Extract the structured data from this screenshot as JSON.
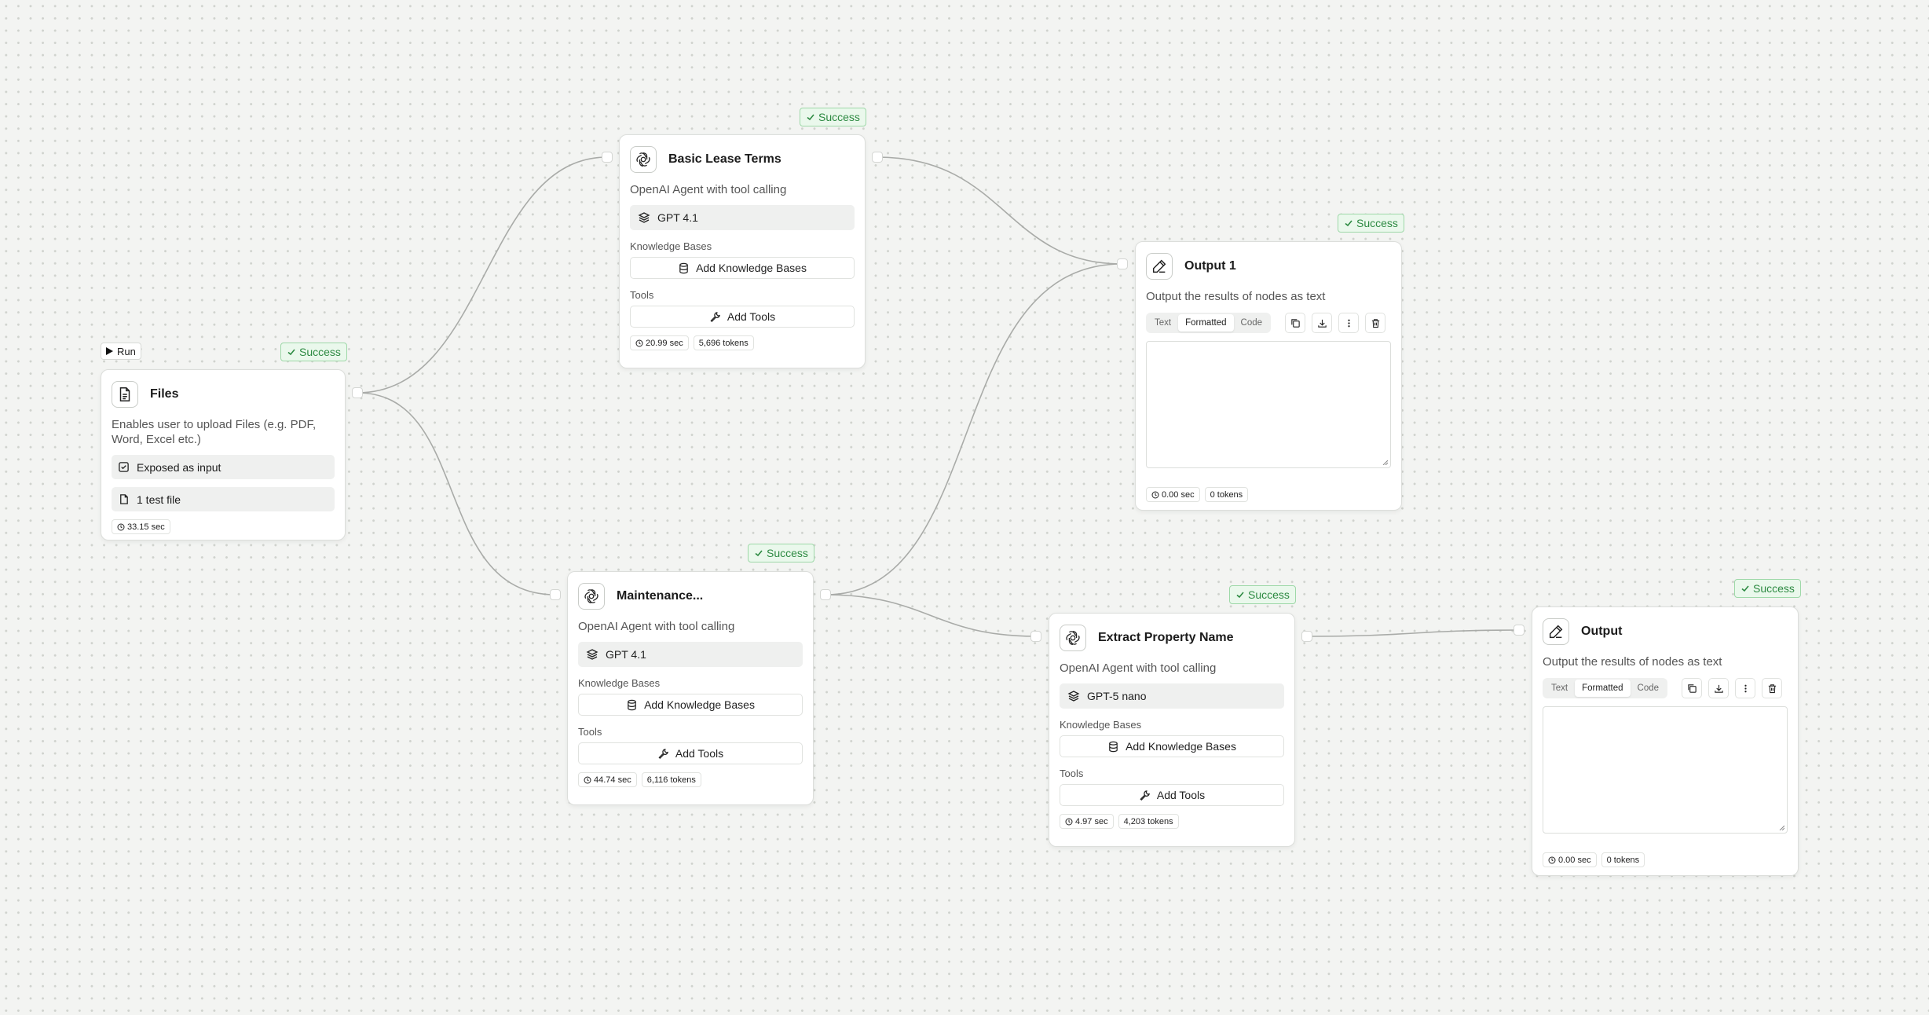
{
  "run_label": "Run",
  "success_label": "Success",
  "nodes": {
    "files": {
      "title": "Files",
      "description": "Enables user to upload Files (e.g. PDF, Word, Excel etc.)",
      "exposed": "Exposed as input",
      "file_count": "1 test file",
      "time": "33.15 sec"
    },
    "basic": {
      "title": "Basic Lease Terms",
      "description": "OpenAI Agent with tool calling",
      "model": "GPT 4.1",
      "kb_label": "Knowledge Bases",
      "kb_button": "Add Knowledge Bases",
      "tools_label": "Tools",
      "tools_button": "Add Tools",
      "time": "20.99 sec",
      "tokens": "5,696 tokens"
    },
    "maintenance": {
      "title": "Maintenance...",
      "description": "OpenAI Agent with tool calling",
      "model": "GPT 4.1",
      "kb_label": "Knowledge Bases",
      "kb_button": "Add Knowledge Bases",
      "tools_label": "Tools",
      "tools_button": "Add Tools",
      "time": "44.74 sec",
      "tokens": "6,116 tokens"
    },
    "extract": {
      "title": "Extract Property Name",
      "description": "OpenAI Agent with tool calling",
      "model": "GPT-5 nano",
      "kb_label": "Knowledge Bases",
      "kb_button": "Add Knowledge Bases",
      "tools_label": "Tools",
      "tools_button": "Add Tools",
      "time": "4.97 sec",
      "tokens": "4,203 tokens"
    },
    "output1": {
      "title": "Output 1",
      "description": "Output the results of nodes as text",
      "tab_text": "Text",
      "tab_formatted": "Formatted",
      "tab_code": "Code",
      "time": "0.00 sec",
      "tokens": "0 tokens"
    },
    "output": {
      "title": "Output",
      "description": "Output the results of nodes as text",
      "tab_text": "Text",
      "tab_formatted": "Formatted",
      "tab_code": "Code",
      "time": "0.00 sec",
      "tokens": "0 tokens"
    }
  },
  "icons": {
    "agent": "openai-icon",
    "model": "layers-icon",
    "kb": "database-icon",
    "tools": "wrench-icon",
    "output": "pencil-icon",
    "files": "file-text-icon"
  },
  "colors": {
    "success_text": "#2d8a42",
    "success_bg": "#eaf8ec",
    "success_border": "#9ed8a8",
    "edge": "#a9aba8"
  }
}
